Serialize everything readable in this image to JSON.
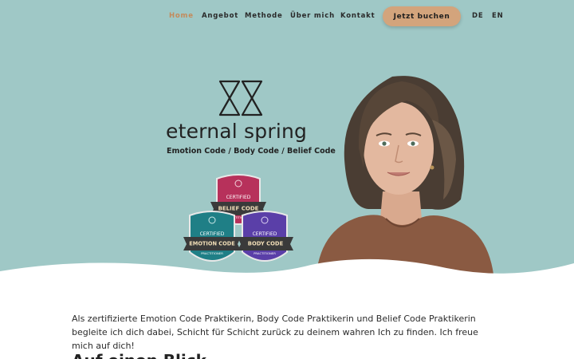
{
  "nav": {
    "items": [
      {
        "label": "Home",
        "active": true
      },
      {
        "label": "Angebot",
        "active": false
      },
      {
        "label": "Methode",
        "active": false
      },
      {
        "label": "Über mich",
        "active": false
      },
      {
        "label": "Kontakt",
        "active": false
      }
    ],
    "cta_label": "Jetzt buchen",
    "languages": [
      "DE",
      "EN"
    ]
  },
  "hero": {
    "brand": "eternal spring",
    "tagline": "Emotion Code / Body Code / Belief Code",
    "badges": [
      {
        "top_text": "CERTIFIED",
        "name": "BELIEF CODE",
        "bottom_text": "PRACTITIONER",
        "color": "#b7315b"
      },
      {
        "top_text": "CERTIFIED",
        "name": "EMOTION CODE",
        "bottom_text": "PRACTITIONER",
        "color": "#1f7f86"
      },
      {
        "top_text": "CERTIFIED",
        "name": "BODY CODE",
        "bottom_text": "PRACTITIONER",
        "color": "#5a3fa8"
      }
    ]
  },
  "content": {
    "intro": "Als zertifizierte Emotion Code Praktikerin, Body Code Praktikerin und Belief Code Praktikerin begleite ich dich dabei, Schicht für Schicht zurück zu deinem wahren Ich zu finden. Ich freue mich auf dich!",
    "heading": "Auf einen Blick"
  },
  "colors": {
    "hero_bg": "#9fc8c6",
    "accent": "#c48a5a",
    "cta_bg": "#d3a47c"
  }
}
